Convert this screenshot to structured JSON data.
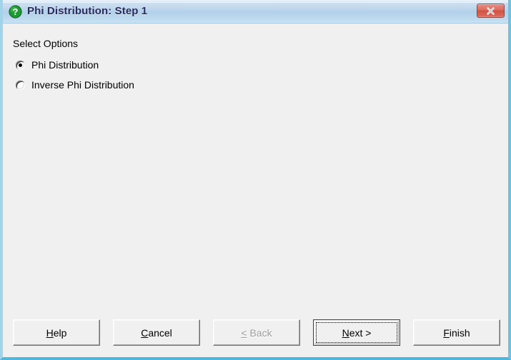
{
  "window": {
    "title": "Phi Distribution: Step 1",
    "icon": "question-mark-icon",
    "close_label": "Close",
    "accent_titlebar": "#b2d0ea",
    "accent_border": "#6fc2e0",
    "client_background": "#f0f0f0",
    "title_color": "#2b2b5e",
    "close_button_color": "#cf5242",
    "icon_color": "#1e9a32"
  },
  "content": {
    "group_label": "Select Options",
    "options": [
      {
        "label": "Phi Distribution",
        "selected": true
      },
      {
        "label": "Inverse Phi Distribution",
        "selected": false
      }
    ]
  },
  "buttons": {
    "help": {
      "label": "Help",
      "accel": "H",
      "pre": "",
      "post": "elp",
      "disabled": false,
      "default": false
    },
    "cancel": {
      "label": "Cancel",
      "accel": "C",
      "pre": "",
      "post": "ancel",
      "disabled": false,
      "default": false
    },
    "back": {
      "label": "< Back",
      "accel": "<",
      "pre": "",
      "post": " Back",
      "disabled": true,
      "default": false
    },
    "next": {
      "label": "Next >",
      "accel": "N",
      "pre": "",
      "post": "ext >",
      "disabled": false,
      "default": true
    },
    "finish": {
      "label": "Finish",
      "accel": "F",
      "pre": "",
      "post": "inish",
      "disabled": false,
      "default": false
    }
  }
}
